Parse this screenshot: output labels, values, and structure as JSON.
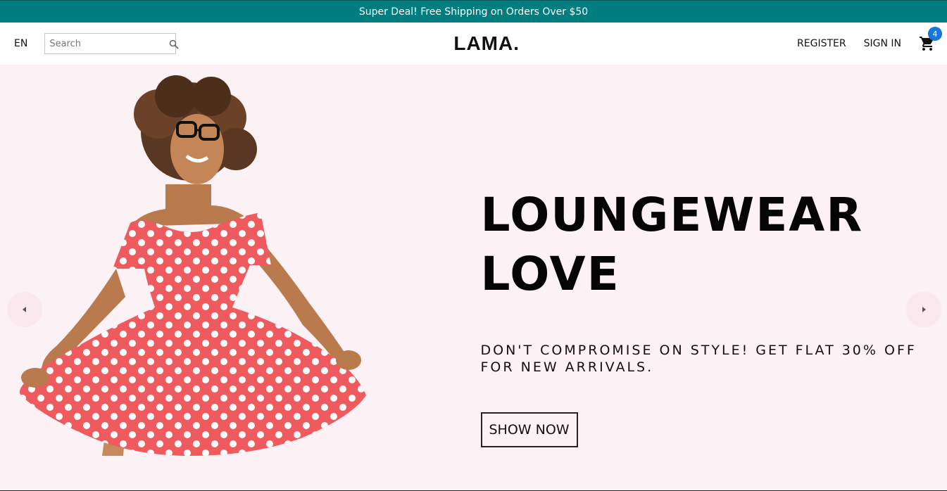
{
  "announcement": {
    "text": "Super Deal! Free Shipping on Orders Over $50"
  },
  "navbar": {
    "language": "EN",
    "search": {
      "placeholder": "Search",
      "value": ""
    },
    "logo": "LAMA.",
    "links": {
      "register": "REGISTER",
      "sign_in": "SIGN IN"
    },
    "cart": {
      "count": "4"
    }
  },
  "slider": {
    "title": "LOUNGEWEAR LOVE",
    "description": "DON'T COMPROMISE ON STYLE! GET FLAT 30% OFF FOR NEW ARRIVALS.",
    "button": "SHOW NOW",
    "arrows": {
      "left": "chevron-left-icon",
      "right": "chevron-right-icon"
    }
  },
  "colors": {
    "announce_bg": "#007e7f",
    "slider_bg": "#fcf1f5",
    "badge": "#1976d2",
    "dress": "#ee5a5e"
  }
}
